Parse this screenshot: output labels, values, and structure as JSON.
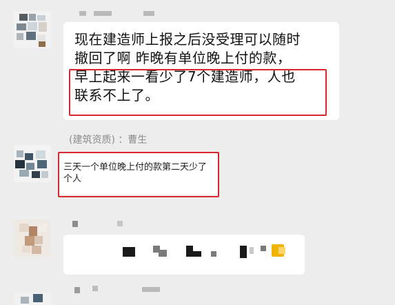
{
  "message_main": {
    "lines": [
      "现在建造师上报之后没受理可以随时",
      "撤回了啊  昨晚有单位晚上付的款，",
      "早上起来一看少了7个建造师，人也",
      "联系不上了。"
    ]
  },
  "message_reply": {
    "sender_label": "(建筑资质) ：曹生",
    "lines": [
      "三天一个单位晚上付的款第二天少了",
      "个人"
    ]
  },
  "colors": {
    "background": "#ededed",
    "bubble": "#ffffff",
    "highlight": "#d8282d",
    "file_icon": "#f0b400"
  },
  "icons": {
    "redacted_message": "pixelated-redaction",
    "file_icon": "folder-icon"
  }
}
